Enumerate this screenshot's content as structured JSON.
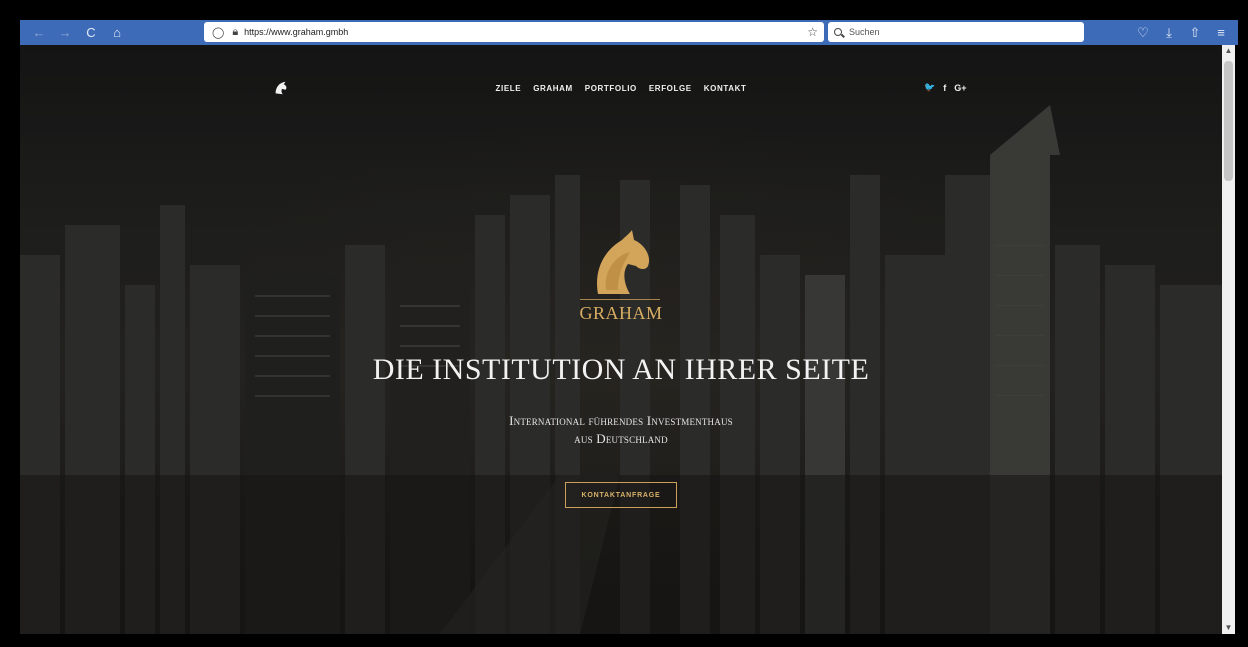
{
  "browser": {
    "url": "https://www.graham.gmbh",
    "search_placeholder": "Suchen",
    "back_icon": "←",
    "forward_icon": "→",
    "reload_icon": "C",
    "home_icon": "⌂",
    "bookmark_icon": "☆",
    "pocket_icon": "♡",
    "download_icon": "⤓",
    "extensions_icon": "⇧",
    "menu_icon": "≡"
  },
  "site": {
    "nav": [
      "ZIELE",
      "GRAHAM",
      "PORTFOLIO",
      "ERFOLGE",
      "KONTAKT"
    ],
    "social": [
      "twitter-icon",
      "facebook-icon",
      "google-plus-icon"
    ],
    "social_glyphs": {
      "twitter": "🐦",
      "facebook": "f",
      "google_plus": "G+"
    },
    "brand": "GRAHAM",
    "headline": "DIE INSTITUTION AN IHRER SEITE",
    "subline1": "International führendes Investmenthaus",
    "subline2": "aus Deutschland",
    "cta": "KONTAKTANFRAGE",
    "accent_color": "#d4a85c"
  }
}
